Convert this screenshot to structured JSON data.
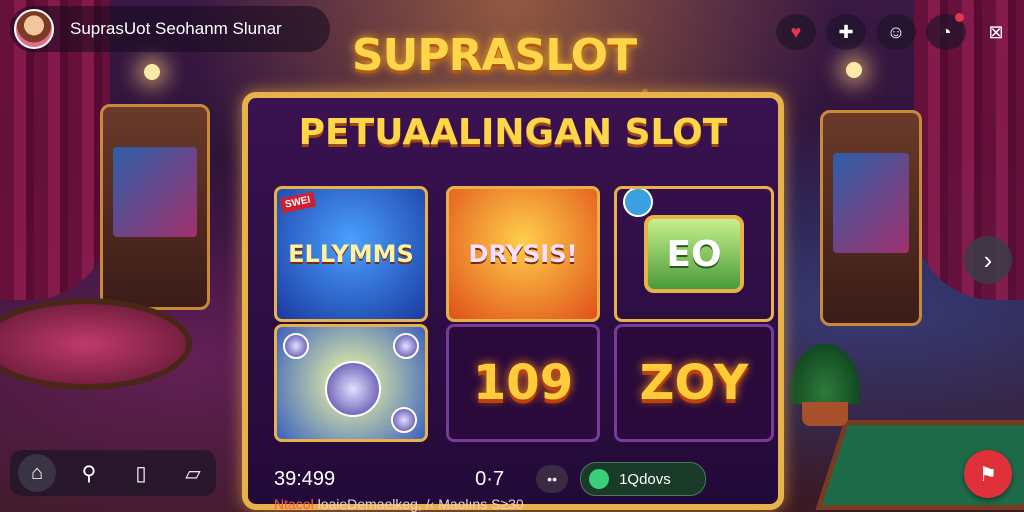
{
  "header": {
    "title": "SuprasUot Seohanm Slunar",
    "icons": [
      "heart-icon",
      "puzzle-icon",
      "cat-face-icon",
      "chat-bubble-icon",
      "close-box-icon"
    ],
    "notification_dot": true
  },
  "logo": {
    "brand": "SUPRASLOT",
    "tm": "®"
  },
  "panel": {
    "subtitle": "PETUAALINGAN SLOT",
    "tiles": [
      {
        "label": "ELLYMMS",
        "badge": "SWEI"
      },
      {
        "label": "DRYSIS!"
      },
      {
        "label": "EO"
      },
      {
        "label": ""
      },
      {
        "label": "109"
      },
      {
        "label": "ZOY"
      }
    ],
    "stats": {
      "left_value": "39:499",
      "center_value": "0·7",
      "pause_label": "••",
      "pill_label": "1Qdovs"
    },
    "footer": {
      "highlight": "Ntacol",
      "text": "loaieDemaelkeg, /‹ Maolıns S≥30"
    }
  },
  "nav": {
    "next_label": "›",
    "fab_icon": "flag-icon",
    "bottom": [
      "home-icon",
      "search-icon",
      "book-icon",
      "gallery-icon"
    ]
  },
  "colors": {
    "accent_gold": "#e8b24a",
    "brand_yellow": "#ffd54a",
    "fab_red": "#e0303a"
  }
}
